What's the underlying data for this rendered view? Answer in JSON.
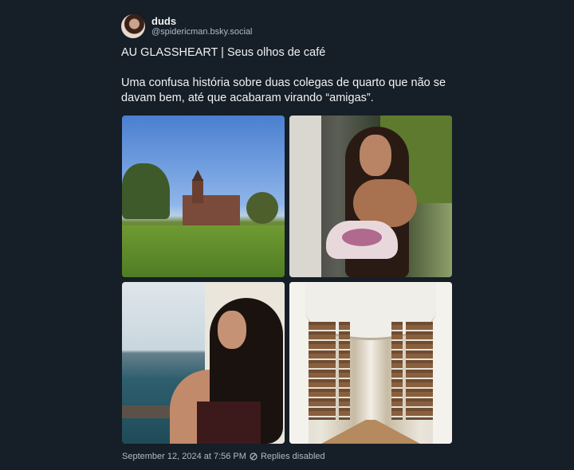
{
  "post": {
    "author": {
      "display_name": "duds",
      "handle": "@spidericman.bsky.social"
    },
    "text": "AU GLASSHEART | Seus olhos de café\n\nUma confusa história sobre duas colegas de quarto que não se davam bem, até que acabaram virando “amigas”.",
    "images": [
      {
        "subject": "campus lawn with red-brick building"
      },
      {
        "subject": "woman with handbag on street"
      },
      {
        "subject": "woman with curly hair by the water"
      },
      {
        "subject": "library hall with bookshelves"
      }
    ],
    "timestamp": "September 12, 2024 at 7:56 PM",
    "replies_status": "Replies disabled",
    "replies_icon": "nope-icon"
  },
  "colors": {
    "background": "#161e27",
    "text_primary": "#f1f3f5",
    "text_secondary": "#aebbc9"
  }
}
